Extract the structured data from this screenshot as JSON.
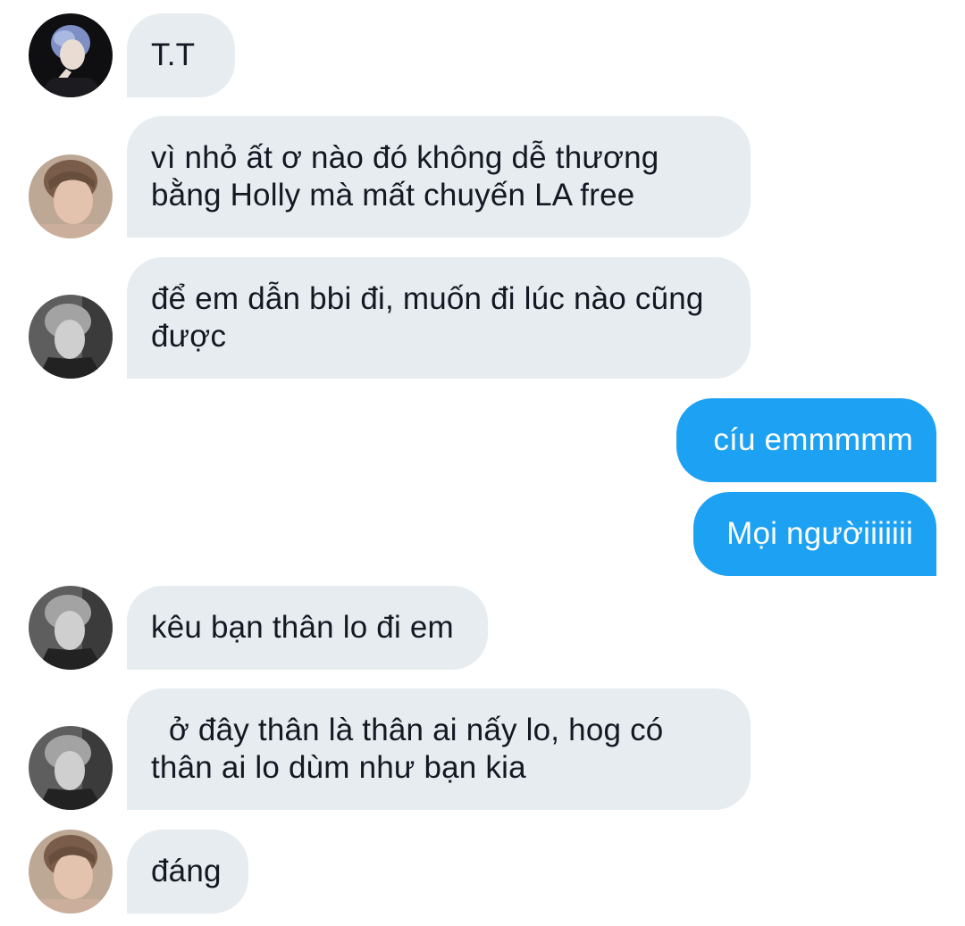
{
  "conversation": {
    "messages": [
      {
        "direction": "incoming",
        "avatar": "avatar-blue-hair",
        "text": "T.T"
      },
      {
        "direction": "incoming",
        "avatar": "avatar-warm",
        "text": "vì nhỏ ất ơ nào đó không dễ thương\nbằng Holly mà mất chuyến LA free"
      },
      {
        "direction": "incoming",
        "avatar": "avatar-grey",
        "text": "để em dẫn bbi đi, muốn đi lúc nào cũng\nđược"
      },
      {
        "direction": "outgoing",
        "text": "cíu emmmmm"
      },
      {
        "direction": "outgoing",
        "text": "Mọi ngườiiiiiii"
      },
      {
        "direction": "incoming",
        "avatar": "avatar-grey",
        "text": "kêu bạn thân lo đi em"
      },
      {
        "direction": "incoming",
        "avatar": "avatar-grey",
        "text": "  ở đây thân là thân ai nấy lo, hog có\nthân ai lo dùm như bạn kia"
      },
      {
        "direction": "incoming",
        "avatar": "avatar-warm",
        "text": "đáng"
      }
    ]
  },
  "colors": {
    "incoming_bubble": "#e6ecf0",
    "outgoing_bubble": "#1da1f2",
    "incoming_text": "#141823",
    "outgoing_text": "#ffffff"
  }
}
